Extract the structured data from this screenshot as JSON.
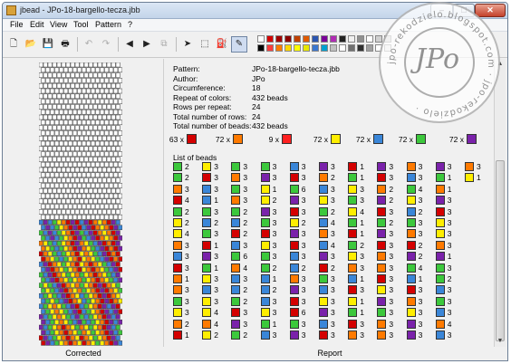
{
  "window": {
    "title": "jbead - JPo-18-bargello-tecza.jbb",
    "minimize_glyph": "–",
    "maximize_glyph": "□",
    "close_glyph": "✕"
  },
  "menu": [
    "File",
    "Edit",
    "View",
    "Tool",
    "Pattern",
    "?"
  ],
  "toolbar": {
    "icons": [
      "new-icon",
      "open-icon",
      "save-icon",
      "print-icon",
      "undo-icon",
      "redo-icon",
      "arrow-left-icon",
      "arrow-right-icon",
      "copy-icon",
      "pointer-icon",
      "select-rect-icon",
      "fill-icon",
      "pipette-icon"
    ],
    "glyphs": [
      "🗋",
      "📂",
      "💾",
      "🖶",
      "↶",
      "↷",
      "◀",
      "▶",
      "⧉",
      "➤",
      "⬚",
      "⛽",
      "✎"
    ]
  },
  "palette": {
    "row1": [
      "#ffffff",
      "#d40000",
      "#a00000",
      "#8b0000",
      "#c04000",
      "#e05a00",
      "#2a55b0",
      "#7a0099",
      "#b02cb4",
      "#222222",
      "#f0f0f0",
      "#909090",
      "#ffffff",
      "#d0d0d0",
      "#c8c8c8"
    ],
    "row2": [
      "#000000",
      "#ff3c3c",
      "#ff7a00",
      "#ffd700",
      "#ffff00",
      "#e8e800",
      "#3a77d0",
      "#00a0d0",
      "#c0c0c0",
      "#ffffff",
      "#707070",
      "#303030",
      "#a0a0a0",
      "#ffffff",
      "#e0e0e0"
    ]
  },
  "pattern_grid": {
    "columns": 18,
    "rows": 54,
    "patterned_rows": 24,
    "colors": [
      "#d40000",
      "#ff7a00",
      "#ffee00",
      "#3cc83c",
      "#3a86d8",
      "#7a22aa"
    ]
  },
  "left_panel_label": "Corrected",
  "report": {
    "label": "Report",
    "info": [
      {
        "key": "Pattern:",
        "value": "JPo-18-bargello-tecza.jbb"
      },
      {
        "key": "Author:",
        "value": "JPo"
      },
      {
        "key": "Circumference:",
        "value": "18"
      },
      {
        "key": "Repeat of colors:",
        "value": "432 beads"
      },
      {
        "key": "Rows per repeat:",
        "value": "24"
      },
      {
        "key": "Total number of rows:",
        "value": "24"
      },
      {
        "key": "Total number of beads:",
        "value": "432 beads"
      }
    ],
    "color_counts": [
      {
        "label": "63 x",
        "color": "#d40000"
      },
      {
        "label": "72 x",
        "color": "#ff7a00"
      },
      {
        "label": "9 x",
        "color": "#ff2020"
      },
      {
        "label": "72 x",
        "color": "#ffee00"
      },
      {
        "label": "72 x",
        "color": "#3a86d8"
      },
      {
        "label": "72 x",
        "color": "#3cc83c"
      },
      {
        "label": "72 x",
        "color": "#7a22aa"
      }
    ],
    "list_title": "List of beads",
    "list_columns": [
      [
        [
          "G",
          "2"
        ],
        [
          "G",
          "2"
        ],
        [
          "O",
          "3"
        ],
        [
          "R",
          "4"
        ],
        [
          "G",
          "2"
        ],
        [
          "Y",
          "2"
        ],
        [
          "Y",
          "4"
        ],
        [
          "O",
          "3"
        ],
        [
          "B",
          "3"
        ],
        [
          "R",
          "3"
        ],
        [
          "O",
          "1"
        ],
        [
          "O",
          "3"
        ],
        [
          "G",
          "3"
        ],
        [
          "Y",
          "3"
        ],
        [
          "O",
          "2"
        ],
        [
          "R",
          "1"
        ]
      ],
      [
        [
          "Y",
          "3"
        ],
        [
          "R",
          "3"
        ],
        [
          "B",
          "3"
        ],
        [
          "B",
          "1"
        ],
        [
          "G",
          "3"
        ],
        [
          "B",
          "2"
        ],
        [
          "G",
          "3"
        ],
        [
          "R",
          "1"
        ],
        [
          "P",
          "3"
        ],
        [
          "G",
          "1"
        ],
        [
          "Y",
          "3"
        ],
        [
          "B",
          "3"
        ],
        [
          "Y",
          "3"
        ],
        [
          "Y",
          "4"
        ],
        [
          "O",
          "4"
        ],
        [
          "Y",
          "2"
        ]
      ],
      [
        [
          "G",
          "3"
        ],
        [
          "O",
          "3"
        ],
        [
          "G",
          "3"
        ],
        [
          "O",
          "3"
        ],
        [
          "G",
          "2"
        ],
        [
          "B",
          "2"
        ],
        [
          "R",
          "2"
        ],
        [
          "B",
          "3"
        ],
        [
          "G",
          "6"
        ],
        [
          "O",
          "4"
        ],
        [
          "B",
          "3"
        ],
        [
          "B",
          "2"
        ],
        [
          "G",
          "2"
        ],
        [
          "R",
          "3"
        ],
        [
          "P",
          "3"
        ],
        [
          "G",
          "2"
        ]
      ],
      [
        [
          "G",
          "3"
        ],
        [
          "P",
          "3"
        ],
        [
          "Y",
          "1"
        ],
        [
          "Y",
          "2"
        ],
        [
          "P",
          "3"
        ],
        [
          "G",
          "3"
        ],
        [
          "R",
          "3"
        ],
        [
          "Y",
          "3"
        ],
        [
          "G",
          "3"
        ],
        [
          "G",
          "2"
        ],
        [
          "B",
          "1"
        ],
        [
          "B",
          "2"
        ],
        [
          "B",
          "3"
        ],
        [
          "Y",
          "3"
        ],
        [
          "G",
          "1"
        ],
        [
          "B",
          "3"
        ]
      ],
      [
        [
          "B",
          "3"
        ],
        [
          "R",
          "3"
        ],
        [
          "G",
          "6"
        ],
        [
          "P",
          "3"
        ],
        [
          "R",
          "3"
        ],
        [
          "Y",
          "2"
        ],
        [
          "P",
          "3"
        ],
        [
          "R",
          "3"
        ],
        [
          "B",
          "3"
        ],
        [
          "B",
          "2"
        ],
        [
          "O",
          "3"
        ],
        [
          "P",
          "3"
        ],
        [
          "R",
          "3"
        ],
        [
          "R",
          "6"
        ],
        [
          "G",
          "3"
        ],
        [
          "P",
          "3"
        ]
      ],
      [
        [
          "P",
          "3"
        ],
        [
          "O",
          "2"
        ],
        [
          "B",
          "3"
        ],
        [
          "Y",
          "3"
        ],
        [
          "G",
          "2"
        ],
        [
          "B",
          "4"
        ],
        [
          "O",
          "3"
        ],
        [
          "B",
          "4"
        ],
        [
          "P",
          "3"
        ],
        [
          "R",
          "2"
        ],
        [
          "G",
          "3"
        ],
        [
          "B",
          "3"
        ],
        [
          "Y",
          "3"
        ],
        [
          "P",
          "3"
        ],
        [
          "B",
          "3"
        ],
        [
          "R",
          "3"
        ]
      ],
      [
        [
          "R",
          "1"
        ],
        [
          "G",
          "1"
        ],
        [
          "Y",
          "3"
        ],
        [
          "G",
          "3"
        ],
        [
          "Y",
          "4"
        ],
        [
          "G",
          "1"
        ],
        [
          "R",
          "1"
        ],
        [
          "G",
          "2"
        ],
        [
          "Y",
          "3"
        ],
        [
          "O",
          "3"
        ],
        [
          "B",
          "1"
        ],
        [
          "R",
          "3"
        ],
        [
          "Y",
          "1"
        ],
        [
          "G",
          "1"
        ],
        [
          "R",
          "3"
        ],
        [
          "O",
          "3"
        ]
      ],
      [
        [
          "P",
          "3"
        ],
        [
          "R",
          "3"
        ],
        [
          "O",
          "2"
        ],
        [
          "P",
          "2"
        ],
        [
          "R",
          "3"
        ],
        [
          "G",
          "2"
        ],
        [
          "P",
          "3"
        ],
        [
          "R",
          "3"
        ],
        [
          "O",
          "3"
        ],
        [
          "O",
          "3"
        ],
        [
          "R",
          "3"
        ],
        [
          "Y",
          "3"
        ],
        [
          "P",
          "3"
        ],
        [
          "G",
          "3"
        ],
        [
          "O",
          "3"
        ],
        [
          "O",
          "3"
        ]
      ],
      [
        [
          "O",
          "3"
        ],
        [
          "B",
          "3"
        ],
        [
          "G",
          "4"
        ],
        [
          "Y",
          "3"
        ],
        [
          "B",
          "2"
        ],
        [
          "G",
          "3"
        ],
        [
          "O",
          "3"
        ],
        [
          "R",
          "2"
        ],
        [
          "P",
          "2"
        ],
        [
          "G",
          "4"
        ],
        [
          "B",
          "1"
        ],
        [
          "R",
          "3"
        ],
        [
          "O",
          "3"
        ],
        [
          "Y",
          "3"
        ],
        [
          "P",
          "3"
        ],
        [
          "P",
          "3"
        ]
      ],
      [
        [
          "P",
          "3"
        ],
        [
          "G",
          "1"
        ],
        [
          "O",
          "1"
        ],
        [
          "P",
          "3"
        ],
        [
          "R",
          "3"
        ],
        [
          "Y",
          "3"
        ],
        [
          "Y",
          "3"
        ],
        [
          "O",
          "3"
        ],
        [
          "P",
          "1"
        ],
        [
          "G",
          "3"
        ],
        [
          "G",
          "2"
        ],
        [
          "B",
          "3"
        ],
        [
          "G",
          "3"
        ],
        [
          "B",
          "3"
        ],
        [
          "O",
          "4"
        ],
        [
          "B",
          "3"
        ]
      ],
      [
        [
          "O",
          "3"
        ],
        [
          "Y",
          "1"
        ]
      ]
    ]
  }
}
